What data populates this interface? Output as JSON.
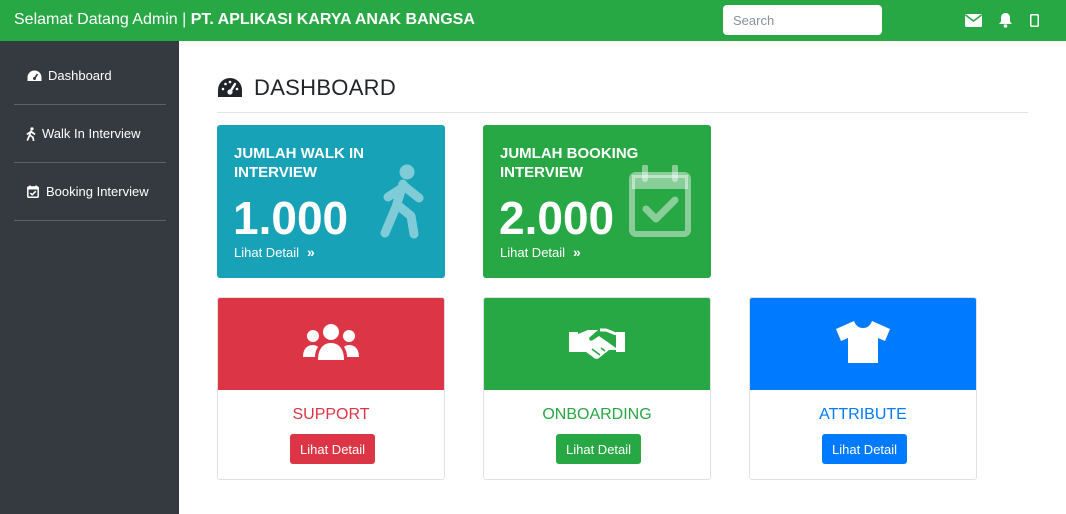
{
  "topbar": {
    "welcome": "Selamat Datang Admin | ",
    "company": "PT. APLIKASI KARYA ANAK BANGSA",
    "search_placeholder": "Search",
    "icons": [
      "envelope-icon",
      "bell-icon",
      "mobile-icon"
    ]
  },
  "sidebar": {
    "items": [
      {
        "label": "Dashboard",
        "icon": "dashboard-icon"
      },
      {
        "label": "Walk In Interview",
        "icon": "walking-icon"
      },
      {
        "label": "Booking Interview",
        "icon": "calendar-check-icon"
      }
    ]
  },
  "main": {
    "title": "DASHBOARD",
    "stats": [
      {
        "label": "JUMLAH WALK IN INTERVIEW",
        "value": "1.000",
        "link": "Lihat Detail",
        "color": "#17a2b8",
        "icon": "walking-icon"
      },
      {
        "label": "JUMLAH BOOKING INTERVIEW",
        "value": "2.000",
        "link": "Lihat Detail",
        "color": "#28a745",
        "icon": "calendar-check-icon"
      }
    ],
    "cards": [
      {
        "title": "SUPPORT",
        "button": "Lihat Detail",
        "color": "#dc3545",
        "icon": "users-icon"
      },
      {
        "title": "ONBOARDING",
        "button": "Lihat Detail",
        "color": "#28a745",
        "icon": "handshake-icon"
      },
      {
        "title": "ATTRIBUTE",
        "button": "Lihat Detail",
        "color": "#007bff",
        "icon": "tshirt-icon"
      }
    ]
  },
  "colors": {
    "navbar": "#28a745",
    "sidebar": "#343a40",
    "info": "#17a2b8",
    "success": "#28a745",
    "danger": "#dc3545",
    "primary": "#007bff"
  }
}
